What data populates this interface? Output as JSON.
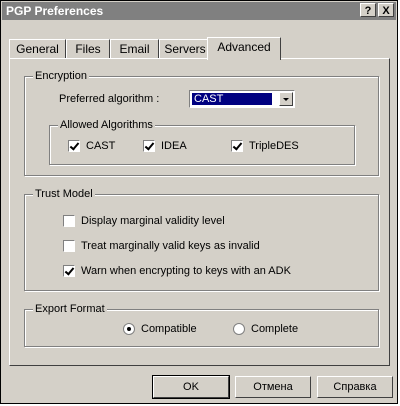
{
  "window": {
    "title": "PGP Preferences"
  },
  "titlebar_buttons": {
    "help": "?",
    "close": "X"
  },
  "tabs": [
    {
      "label": "General"
    },
    {
      "label": "Files"
    },
    {
      "label": "Email"
    },
    {
      "label": "Servers"
    },
    {
      "label": "Advanced"
    }
  ],
  "encryption": {
    "legend": "Encryption",
    "preferred_label": "Preferred algorithm :",
    "preferred_value": "CAST",
    "allowed_legend": "Allowed Algorithms",
    "algorithms": [
      {
        "label": "CAST",
        "checked": true
      },
      {
        "label": "IDEA",
        "checked": true
      },
      {
        "label": "TripleDES",
        "checked": true
      }
    ]
  },
  "trust_model": {
    "legend": "Trust Model",
    "options": [
      {
        "label": "Display marginal validity level",
        "checked": false
      },
      {
        "label": "Treat marginally valid keys as invalid",
        "checked": false
      },
      {
        "label": "Warn when encrypting to keys with an ADK",
        "checked": true
      }
    ]
  },
  "export_format": {
    "legend": "Export Format",
    "options": [
      {
        "label": "Compatible",
        "selected": true
      },
      {
        "label": "Complete",
        "selected": false
      }
    ]
  },
  "footer": {
    "ok": "OK",
    "cancel": "Отмена",
    "help": "Справка"
  }
}
